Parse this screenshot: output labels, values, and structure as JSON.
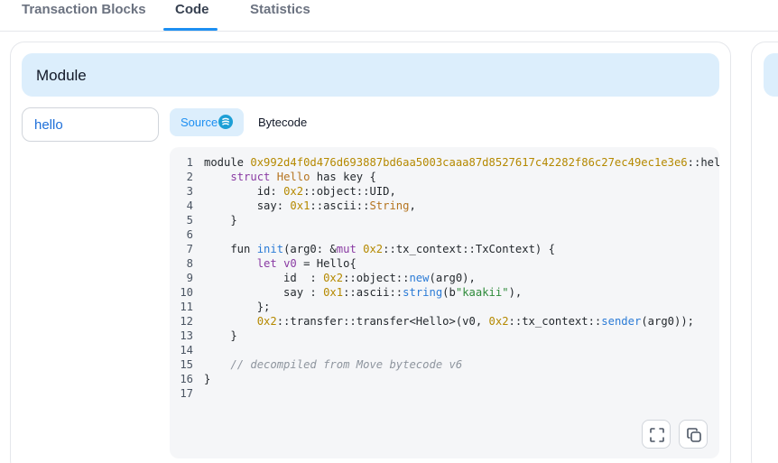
{
  "tabs": [
    "Transaction Blocks",
    "Code",
    "Statistics"
  ],
  "module_panel": {
    "title": "Module",
    "selected_module": "hello"
  },
  "view_toggle": {
    "source_label": "Source",
    "bytecode_label": "Bytecode"
  },
  "code": {
    "lines": [
      "1",
      "2",
      "3",
      "4",
      "5",
      "6",
      "7",
      "8",
      "9",
      "10",
      "11",
      "12",
      "13",
      "14",
      "15",
      "16",
      "17"
    ],
    "tokens": {
      "l1_a": "module ",
      "l1_b": "0x992d4f0d476d693887bd6aa5003caaa87d8527617c42282f86c27ec49ec1e3e6",
      "l1_c": "::hello",
      "l2_a": "    ",
      "l2_b": "struct",
      "l2_c": " ",
      "l2_d": "Hello",
      "l2_e": " has key {",
      "l3_a": "        id: ",
      "l3_b": "0x2",
      "l3_c": "::object::UID,",
      "l4_a": "        say: ",
      "l4_b": "0x1",
      "l4_c": "::ascii::",
      "l4_d": "String",
      "l4_e": ",",
      "l5": "    }",
      "l7_a": "    fun ",
      "l7_b": "init",
      "l7_c": "(arg0: &",
      "l7_d": "mut",
      "l7_e": " ",
      "l7_f": "0x2",
      "l7_g": "::tx_context::TxContext) {",
      "l8_a": "        ",
      "l8_b": "let",
      "l8_c": " ",
      "l8_d": "v0",
      "l8_e": " = Hello{",
      "l9_a": "            id  : ",
      "l9_b": "0x2",
      "l9_c": "::object::",
      "l9_d": "new",
      "l9_e": "(arg0),",
      "l10_a": "            say : ",
      "l10_b": "0x1",
      "l10_c": "::ascii::",
      "l10_d": "string",
      "l10_e": "(b",
      "l10_f": "\"kaakii\"",
      "l10_g": "),",
      "l11": "        };",
      "l12_a": "        ",
      "l12_b": "0x2",
      "l12_c": "::transfer::transfer<Hello>(v0, ",
      "l12_d": "0x2",
      "l12_e": "::tx_context::",
      "l12_f": "sender",
      "l12_g": "(arg0));",
      "l13": "    }",
      "l15_a": "    ",
      "l15_b": "// decompiled from Move bytecode v6",
      "l16": "}"
    }
  },
  "icons": {
    "source": "sui-logo-icon",
    "fullscreen": "fullscreen-icon",
    "copy": "copy-icon"
  },
  "colors": {
    "accent": "#1d8ff2",
    "header_bg": "#dceefc",
    "module_link": "#1e6fd9",
    "code_bg": "#f5f6f8"
  }
}
